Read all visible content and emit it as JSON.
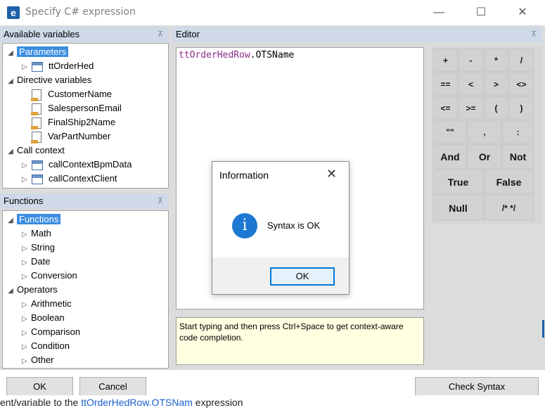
{
  "window": {
    "title": "Specify C# expression",
    "minimize": "—",
    "maximize": "☐",
    "close": "✕"
  },
  "variables_panel": {
    "header": "Available variables",
    "pin": "⊼",
    "tree": [
      {
        "level": 0,
        "expander": "◢",
        "label": "Parameters",
        "selected": true,
        "icon": "none"
      },
      {
        "level": 1,
        "expander": "▷",
        "label": "ttOrderHed",
        "icon": "table-icon"
      },
      {
        "level": 0,
        "expander": "◢",
        "label": "Directive variables",
        "icon": "none"
      },
      {
        "level": 1,
        "expander": "",
        "label": "CustomerName",
        "icon": "variable-icon"
      },
      {
        "level": 1,
        "expander": "",
        "label": "SalespersonEmail",
        "icon": "variable-icon"
      },
      {
        "level": 1,
        "expander": "",
        "label": "FinalShip2Name",
        "icon": "variable-icon"
      },
      {
        "level": 1,
        "expander": "",
        "label": "VarPartNumber",
        "icon": "variable-icon"
      },
      {
        "level": 0,
        "expander": "◢",
        "label": "Call context",
        "icon": "none"
      },
      {
        "level": 1,
        "expander": "▷",
        "label": "callContextBpmData",
        "icon": "table-icon"
      },
      {
        "level": 1,
        "expander": "▷",
        "label": "callContextClient",
        "icon": "table-icon"
      }
    ]
  },
  "functions_panel": {
    "header": "Functions",
    "pin": "⊼",
    "tree": [
      {
        "level": 0,
        "expander": "◢",
        "label": "Functions",
        "selected": true
      },
      {
        "level": 1,
        "expander": "▷",
        "label": "Math"
      },
      {
        "level": 1,
        "expander": "▷",
        "label": "String"
      },
      {
        "level": 1,
        "expander": "▷",
        "label": "Date"
      },
      {
        "level": 1,
        "expander": "▷",
        "label": "Conversion"
      },
      {
        "level": 0,
        "expander": "◢",
        "label": "Operators"
      },
      {
        "level": 1,
        "expander": "▷",
        "label": "Arithmetic"
      },
      {
        "level": 1,
        "expander": "▷",
        "label": "Boolean"
      },
      {
        "level": 1,
        "expander": "▷",
        "label": "Comparison"
      },
      {
        "level": 1,
        "expander": "▷",
        "label": "Condition"
      },
      {
        "level": 1,
        "expander": "▷",
        "label": "Other"
      }
    ]
  },
  "editor": {
    "header": "Editor",
    "pin": "⊼",
    "code_object": "ttOrderHedRow",
    "code_member": ".OTSName",
    "hint": "Start typing and then press Ctrl+Space to get context-aware code completion."
  },
  "operators": {
    "row1": [
      "+",
      "-",
      "*",
      "/"
    ],
    "row2": [
      "==",
      "<",
      ">",
      "<>"
    ],
    "row3": [
      "<=",
      ">=",
      "(",
      ")"
    ],
    "row4": [
      "\"\"",
      ",",
      ":"
    ],
    "row5": [
      "And",
      "Or",
      "Not"
    ],
    "row6": [
      "True",
      "False"
    ],
    "row7": [
      "Null",
      "/* */"
    ]
  },
  "buttons": {
    "ok": "OK",
    "cancel": "Cancel",
    "check_syntax": "Check Syntax"
  },
  "footer": {
    "prefix": "ent/variable to the ",
    "link": "ttOrderHedRow.OTSNam",
    "suffix": "  expression"
  },
  "dialog": {
    "title": "Information",
    "close": "✕",
    "icon": "i",
    "message": "Syntax is OK",
    "ok": "OK"
  },
  "colors": {
    "panel_header": "#cfd9e7",
    "selection": "#3b8de0",
    "info_icon": "#1d78d1",
    "hint_background": "#ffffe1"
  }
}
